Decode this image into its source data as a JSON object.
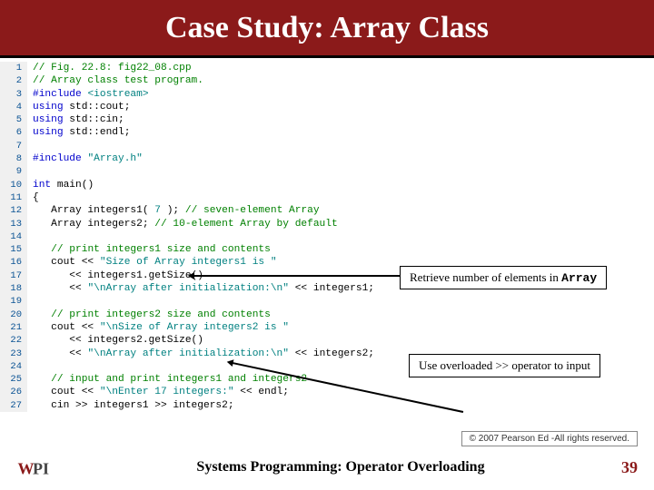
{
  "header": {
    "title": "Case Study: Array Class"
  },
  "code": {
    "lines": [
      {
        "n": "1",
        "spans": [
          {
            "cls": "c-comment",
            "t": "// Fig. 22.8: fig22_08.cpp"
          }
        ]
      },
      {
        "n": "2",
        "spans": [
          {
            "cls": "c-comment",
            "t": "// Array class test program."
          }
        ]
      },
      {
        "n": "3",
        "spans": [
          {
            "cls": "c-pre",
            "t": "#include "
          },
          {
            "cls": "c-str",
            "t": "<iostream>"
          }
        ]
      },
      {
        "n": "4",
        "spans": [
          {
            "cls": "c-kw",
            "t": "using"
          },
          {
            "cls": "c-nor",
            "t": " std::cout;"
          }
        ]
      },
      {
        "n": "5",
        "spans": [
          {
            "cls": "c-kw",
            "t": "using"
          },
          {
            "cls": "c-nor",
            "t": " std::cin;"
          }
        ]
      },
      {
        "n": "6",
        "spans": [
          {
            "cls": "c-kw",
            "t": "using"
          },
          {
            "cls": "c-nor",
            "t": " std::endl;"
          }
        ]
      },
      {
        "n": "7",
        "spans": [
          {
            "cls": "c-nor",
            "t": " "
          }
        ]
      },
      {
        "n": "8",
        "spans": [
          {
            "cls": "c-pre",
            "t": "#include "
          },
          {
            "cls": "c-str",
            "t": "\"Array.h\""
          }
        ]
      },
      {
        "n": "9",
        "spans": [
          {
            "cls": "c-nor",
            "t": " "
          }
        ]
      },
      {
        "n": "10",
        "spans": [
          {
            "cls": "c-kw",
            "t": "int"
          },
          {
            "cls": "c-nor",
            "t": " main()"
          }
        ]
      },
      {
        "n": "11",
        "spans": [
          {
            "cls": "c-nor",
            "t": "{"
          }
        ]
      },
      {
        "n": "12",
        "spans": [
          {
            "cls": "c-nor",
            "t": "   Array integers1( "
          },
          {
            "cls": "c-str",
            "t": "7"
          },
          {
            "cls": "c-nor",
            "t": " ); "
          },
          {
            "cls": "c-comment",
            "t": "// seven-element Array"
          }
        ]
      },
      {
        "n": "13",
        "spans": [
          {
            "cls": "c-nor",
            "t": "   Array integers2; "
          },
          {
            "cls": "c-comment",
            "t": "// 10-element Array by default"
          }
        ]
      },
      {
        "n": "14",
        "spans": [
          {
            "cls": "c-nor",
            "t": " "
          }
        ]
      },
      {
        "n": "15",
        "spans": [
          {
            "cls": "c-nor",
            "t": "   "
          },
          {
            "cls": "c-comment",
            "t": "// print integers1 size and contents"
          }
        ]
      },
      {
        "n": "16",
        "spans": [
          {
            "cls": "c-nor",
            "t": "   cout << "
          },
          {
            "cls": "c-str",
            "t": "\"Size of Array integers1 is \""
          }
        ]
      },
      {
        "n": "17",
        "spans": [
          {
            "cls": "c-nor",
            "t": "      << integers1.getSize()"
          }
        ]
      },
      {
        "n": "18",
        "spans": [
          {
            "cls": "c-nor",
            "t": "      << "
          },
          {
            "cls": "c-str",
            "t": "\"\\nArray after initialization:\\n\""
          },
          {
            "cls": "c-nor",
            "t": " << integers1;"
          }
        ]
      },
      {
        "n": "19",
        "spans": [
          {
            "cls": "c-nor",
            "t": " "
          }
        ]
      },
      {
        "n": "20",
        "spans": [
          {
            "cls": "c-nor",
            "t": "   "
          },
          {
            "cls": "c-comment",
            "t": "// print integers2 size and contents"
          }
        ]
      },
      {
        "n": "21",
        "spans": [
          {
            "cls": "c-nor",
            "t": "   cout << "
          },
          {
            "cls": "c-str",
            "t": "\"\\nSize of Array integers2 is \""
          }
        ]
      },
      {
        "n": "22",
        "spans": [
          {
            "cls": "c-nor",
            "t": "      << integers2.getSize()"
          }
        ]
      },
      {
        "n": "23",
        "spans": [
          {
            "cls": "c-nor",
            "t": "      << "
          },
          {
            "cls": "c-str",
            "t": "\"\\nArray after initialization:\\n\""
          },
          {
            "cls": "c-nor",
            "t": " << integers2;"
          }
        ]
      },
      {
        "n": "24",
        "spans": [
          {
            "cls": "c-nor",
            "t": " "
          }
        ]
      },
      {
        "n": "25",
        "spans": [
          {
            "cls": "c-nor",
            "t": "   "
          },
          {
            "cls": "c-comment",
            "t": "// input and print integers1 and integers2"
          }
        ]
      },
      {
        "n": "26",
        "spans": [
          {
            "cls": "c-nor",
            "t": "   cout << "
          },
          {
            "cls": "c-str",
            "t": "\"\\nEnter 17 integers:\""
          },
          {
            "cls": "c-nor",
            "t": " << endl;"
          }
        ]
      },
      {
        "n": "27",
        "spans": [
          {
            "cls": "c-nor",
            "t": "   cin >> integers1 >> integers2;"
          }
        ]
      }
    ]
  },
  "callouts": {
    "retrieve": {
      "text": "Retrieve number of elements in ",
      "mono": "Array"
    },
    "overload": {
      "text": "Use overloaded >> operator to input"
    }
  },
  "copyright": "© 2007 Pearson Ed -All rights reserved.",
  "footer": {
    "text": "Systems Programming:  Operator Overloading",
    "page": "39"
  }
}
